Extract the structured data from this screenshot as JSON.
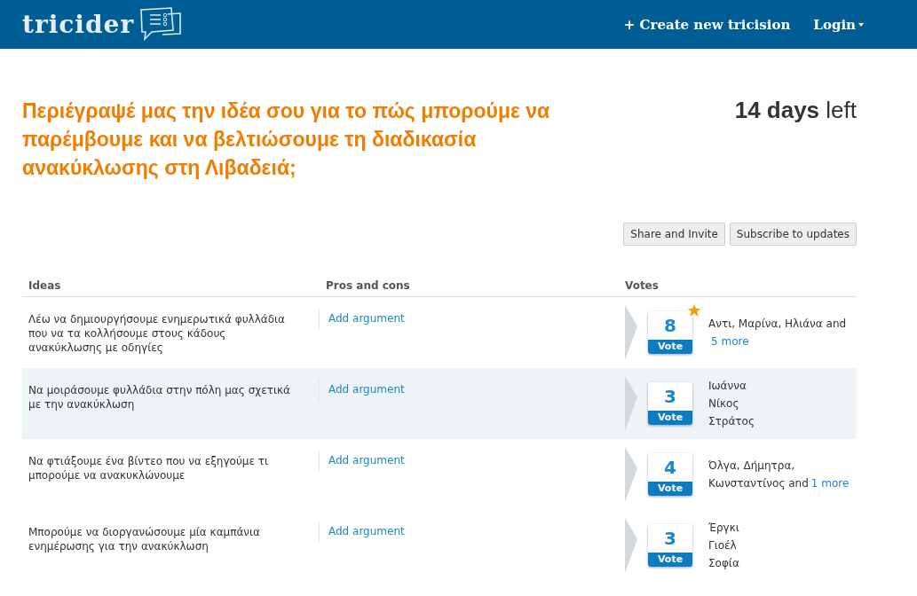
{
  "header": {
    "logo": "tricider",
    "nav": [
      {
        "label": "+ Create new tricision",
        "kind": "link"
      },
      {
        "label": "Login",
        "kind": "dropdown"
      }
    ]
  },
  "question": "Περιέγραψέ μας την ιδέα σου για το πώς μπορούμε να παρέμβουμε και να βελτιώσουμε τη διαδικασία ανακύκλωσης στη Λιβαδειά;",
  "deadline": {
    "count": "14 days",
    "suffix": "left"
  },
  "actions": [
    "Share and Invite",
    "Subscribe to updates"
  ],
  "table": {
    "columns": [
      "Ideas",
      "Pros and cons",
      "Votes"
    ],
    "rows": [
      {
        "idea": "Λέω να δημιουργήσουμε ενημερωτικά φυλλάδια που να τα κολλήσουμε στους κάδους ανακύκλωσης με οδηγίες",
        "argument": "Add argument",
        "votes": "8",
        "vote_label": "Vote",
        "leading": true,
        "highlighted": false,
        "voters": [
          {
            "text": "Αντι, Μαρίνα, Ηλιάνα and"
          },
          {
            "more": "5 more"
          }
        ]
      },
      {
        "idea": "Να μοιράσουμε φυλλάδια στην πόλη μας σχετικά με την ανακύκλωση",
        "argument": "Add argument",
        "votes": "3",
        "vote_label": "Vote",
        "leading": false,
        "highlighted": true,
        "voters": [
          {
            "text": "Ιωάννα"
          },
          {
            "text": "Νίκος"
          },
          {
            "text": "Στράτος"
          }
        ]
      },
      {
        "idea": "Να φτιάξουμε ένα βίντεο που να εξηγούμε τι μπορούμε να ανακυκλώνουμε",
        "argument": "Add argument",
        "votes": "4",
        "vote_label": "Vote",
        "leading": false,
        "highlighted": false,
        "voters": [
          {
            "text": "Όλγα, Δήμητρα,"
          },
          {
            "text": "Κωνσταντίνος and",
            "more": "1 more"
          }
        ]
      },
      {
        "idea": "Μπορούμε να διοργανώσουμε μία καμπάνια ενημέρωσης για την ανακύκλωση",
        "argument": "Add argument",
        "votes": "3",
        "vote_label": "Vote",
        "leading": false,
        "highlighted": false,
        "voters": [
          {
            "text": "Έργκι"
          },
          {
            "text": "Γιοέλ"
          },
          {
            "text": "Σοφία"
          }
        ]
      }
    ]
  }
}
